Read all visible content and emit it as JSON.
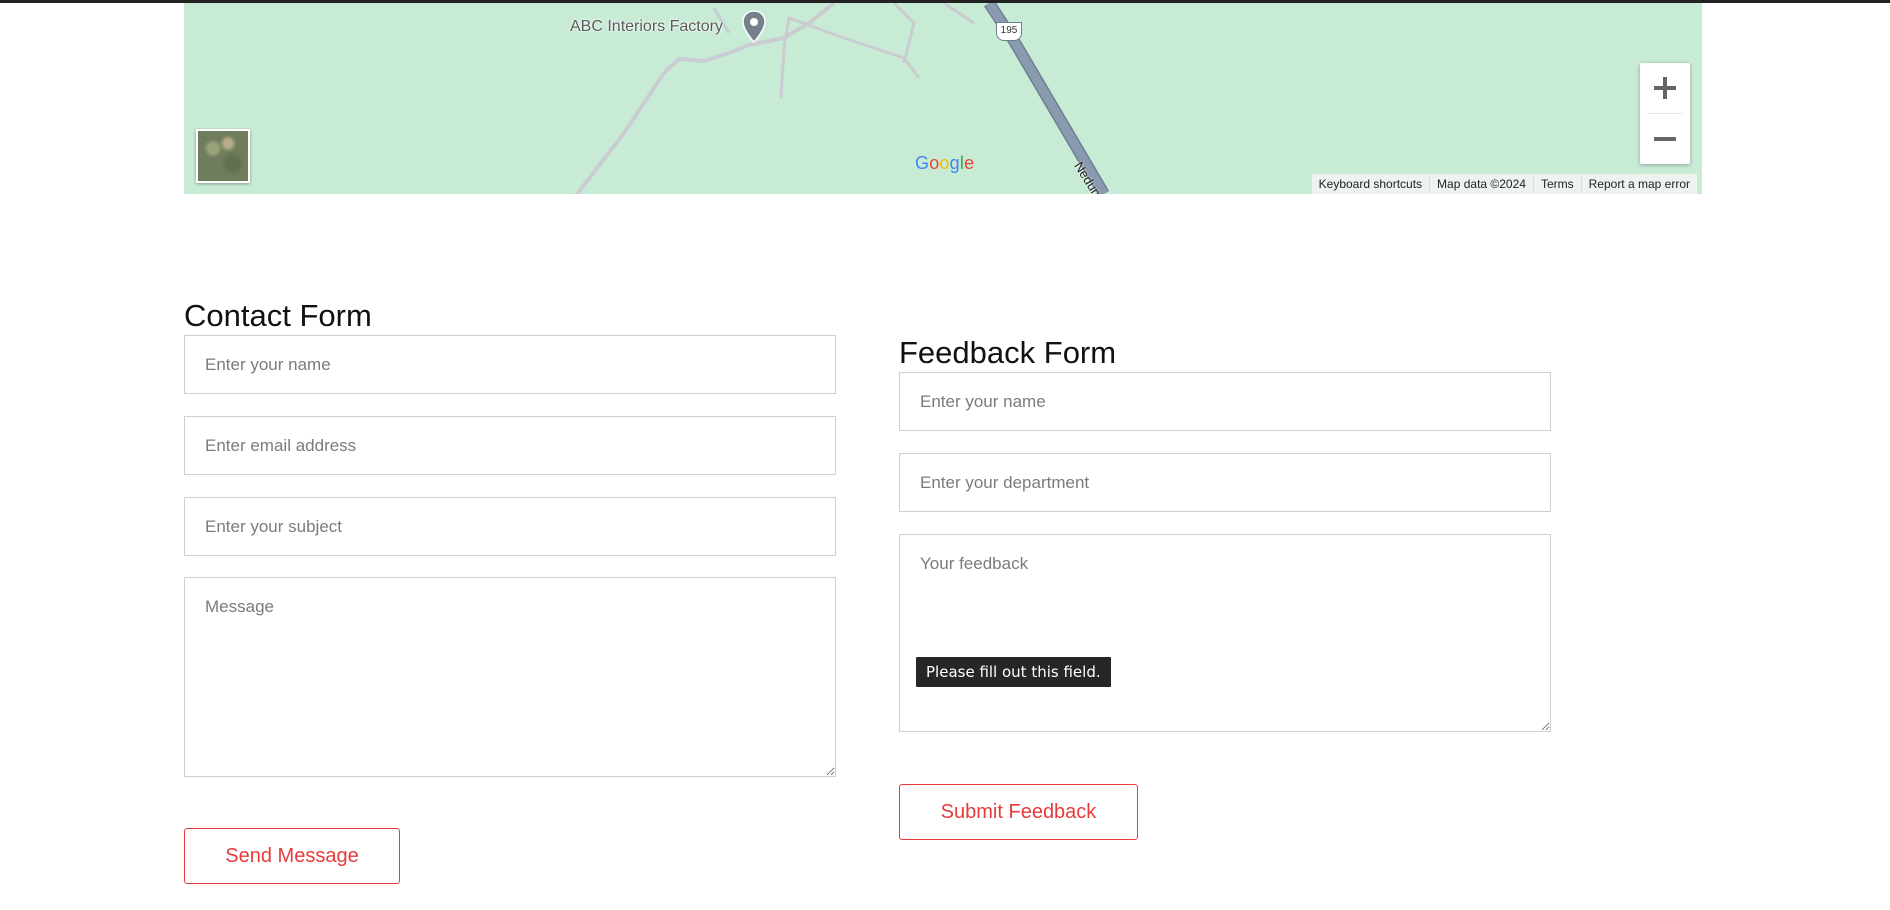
{
  "map": {
    "place_label": "ABC Interiors Factory",
    "route_shield": "195",
    "road_label": "Nedung",
    "google_logo": [
      "G",
      "o",
      "o",
      "g",
      "l",
      "e"
    ],
    "zoom_in_symbol": "+",
    "zoom_out_symbol": "−",
    "attribution": {
      "keyboard": "Keyboard shortcuts",
      "map_data": "Map data ©2024",
      "terms": "Terms",
      "report": "Report a map error"
    },
    "colors": {
      "land": "#c8ebd6",
      "highway": "#8a9bb0",
      "roads": "#c9ccd1"
    }
  },
  "contact_form": {
    "title": "Contact Form",
    "name_placeholder": "Enter your name",
    "email_placeholder": "Enter email address",
    "subject_placeholder": "Enter your subject",
    "message_placeholder": "Message",
    "submit_label": "Send Message"
  },
  "feedback_form": {
    "title": "Feedback Form",
    "name_placeholder": "Enter your name",
    "department_placeholder": "Enter your department",
    "feedback_placeholder": "Your feedback",
    "validation_tooltip": "Please fill out this field.",
    "submit_label": "Submit Feedback"
  },
  "accent_color": "#e83a3a"
}
